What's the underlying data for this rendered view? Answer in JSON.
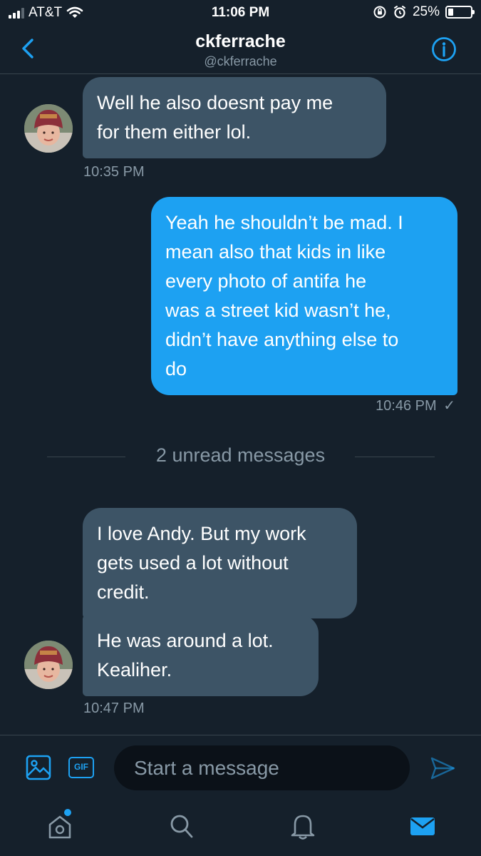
{
  "status": {
    "carrier": "AT&T",
    "time": "11:06 PM",
    "battery": "25%",
    "battery_level": 0.25
  },
  "header": {
    "name": "ckferrache",
    "handle": "@ckferrache"
  },
  "messages": {
    "m1": {
      "line1": "Well he also doesnt pay me",
      "line2": "for them either lol."
    },
    "m1_time": "10:35 PM",
    "m2": {
      "line1": "Yeah he shouldn’t be mad. I",
      "line2": "mean also that kids in like",
      "line3": "every photo of antifa he",
      "line4": "was a street kid wasn’t he,",
      "line5": "didn’t have anything else to",
      "line6": "do"
    },
    "m2_time": "10:46 PM",
    "m2_status": "✓",
    "unread": "2 unread messages",
    "m3": {
      "line1": "I love Andy. But my work",
      "line2": "gets used a lot without",
      "line3": "credit."
    },
    "m4": {
      "line1": "He was around a lot.",
      "line2": "Kealiher."
    },
    "m4_time": "10:47 PM"
  },
  "composer": {
    "placeholder": "Start a message",
    "gif_label": "GIF"
  },
  "tabs": [
    "home-icon",
    "search-icon",
    "bell-icon",
    "mail-icon"
  ],
  "colors": {
    "background": "#15202b",
    "accent": "#1da1f2",
    "incoming_bubble": "#3d5466",
    "muted_text": "#8899a6"
  }
}
